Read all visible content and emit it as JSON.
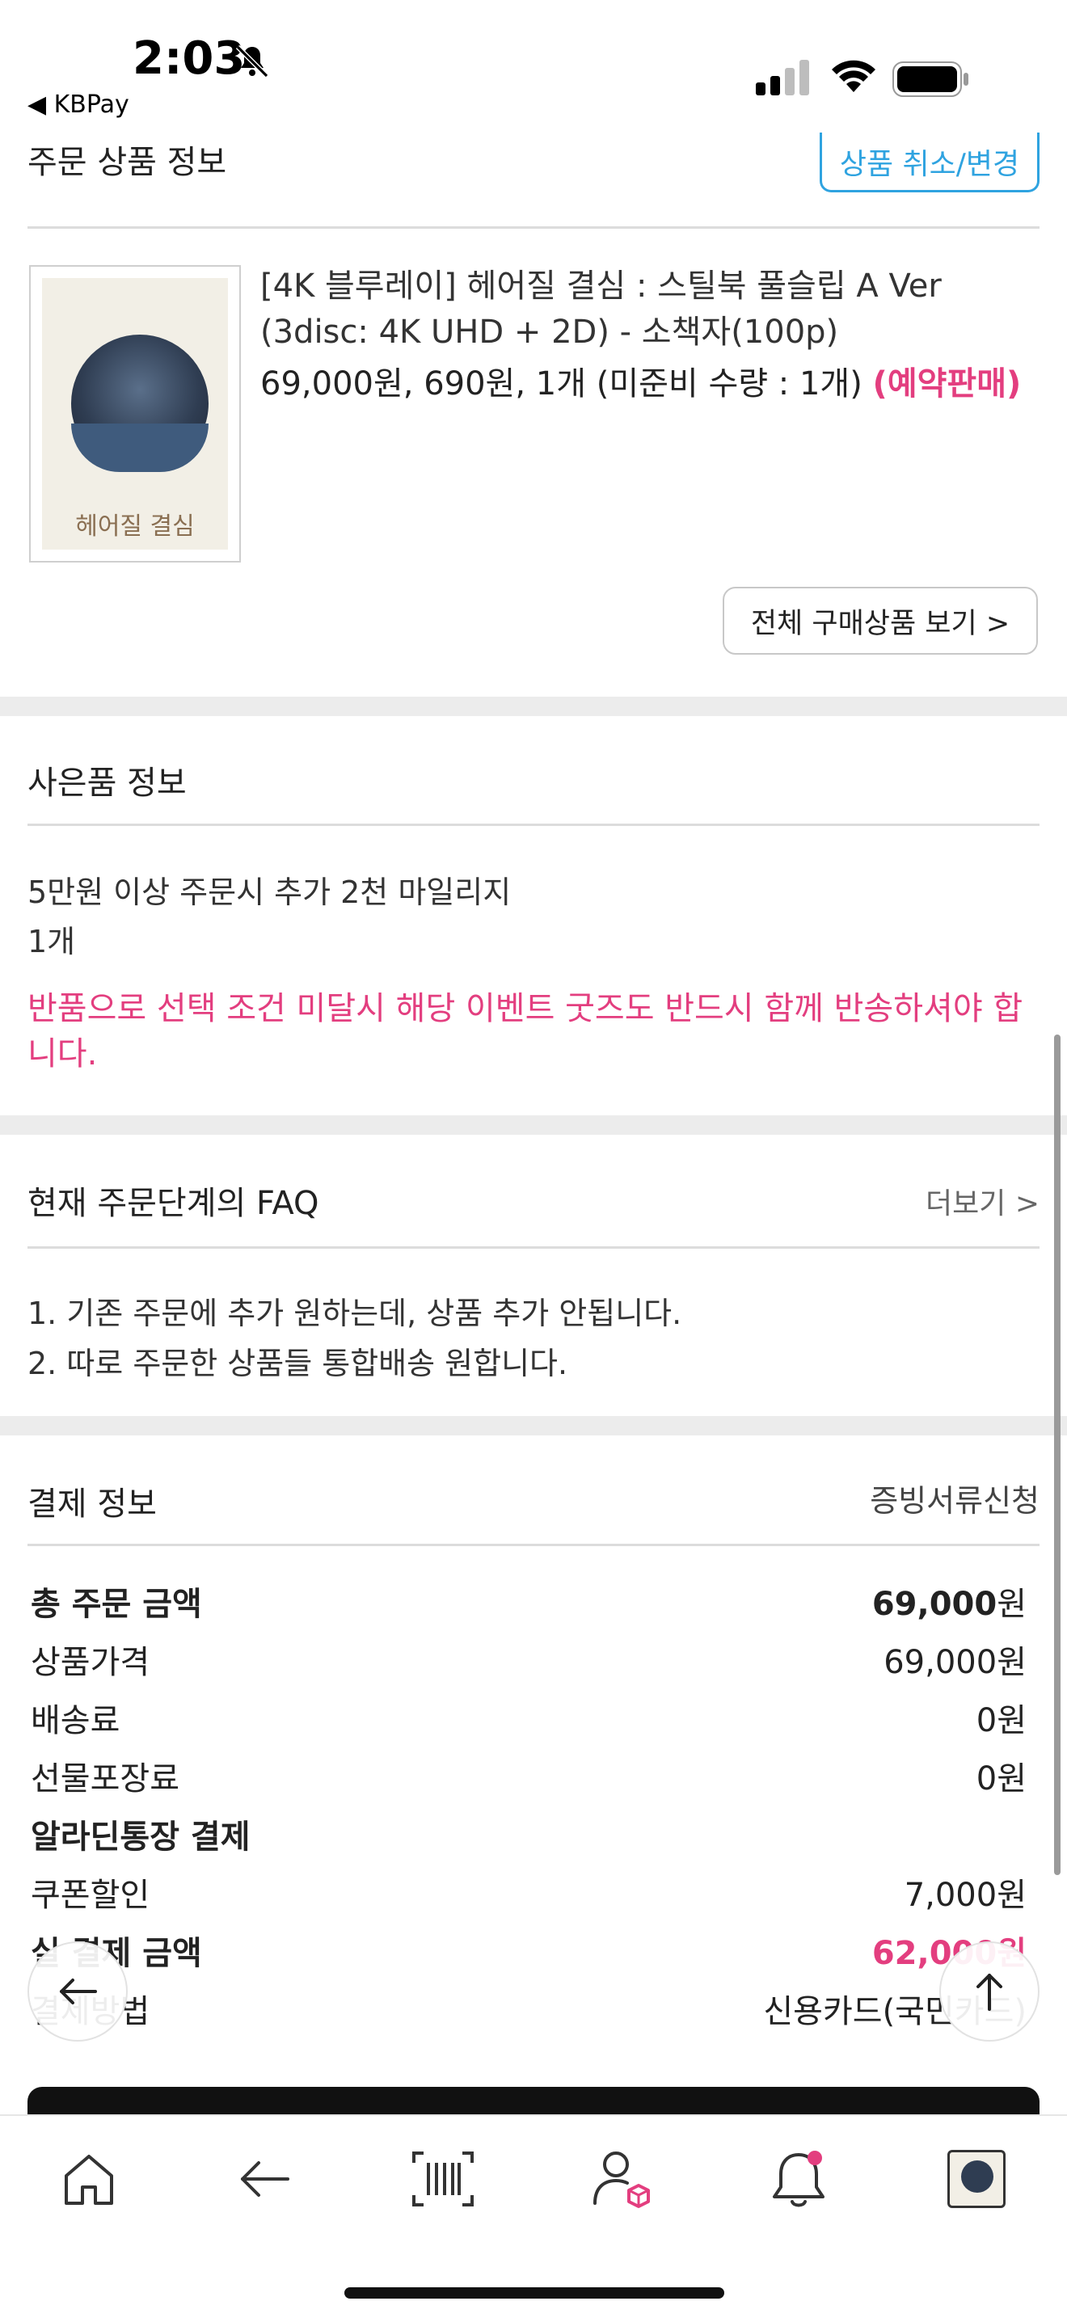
{
  "status_bar": {
    "time": "2:03",
    "back_app": "◀ KBPay"
  },
  "order_section": {
    "title_partial": "주문 상품 정보",
    "cancel_button": "상품 취소/변경",
    "product": {
      "name": "[4K 블루레이] 헤어질 결심 : 스틸북 풀슬립 A Ver (3disc: 4K UHD + 2D) - 소책자(100p)",
      "price_line": "69,000원, 690원, 1개 (미준비 수량 : 1개)",
      "preorder_tag": "(예약판매)",
      "thumbnail_title": "헤어질 결심"
    },
    "view_all_button": "전체 구매상품 보기 >"
  },
  "gift_section": {
    "title": "사은품 정보",
    "item": "5만원 이상 주문시 추가 2천 마일리지",
    "quantity": "1개",
    "notice": "반품으로 선택 조건 미달시 해당 이벤트 굿즈도 반드시 함께 반송하셔야 합니다."
  },
  "faq_section": {
    "title": "현재 주문단계의 FAQ",
    "more_link": "더보기 >",
    "items": [
      "1. 기존 주문에 추가 원하는데, 상품 추가 안됩니다.",
      "2. 따로 주문한 상품들 통합배송 원합니다."
    ]
  },
  "payment_section": {
    "title": "결제 정보",
    "doc_link": "증빙서류신청",
    "rows": [
      {
        "label": "총 주문 금액",
        "value_num": "69,000",
        "value_unit": "원"
      },
      {
        "label": "상품가격",
        "value": "69,000원"
      },
      {
        "label": "배송료",
        "value": "0원"
      },
      {
        "label": "선물포장료",
        "value": "0원"
      },
      {
        "label": "알라딘통장 결제",
        "value": ""
      },
      {
        "label": "쿠폰할인",
        "value": "7,000원"
      },
      {
        "label": "실 결제 금액",
        "value": "62,000원"
      },
      {
        "label": "결제방법",
        "value": "신용카드(국민카드)"
      }
    ]
  },
  "tab_bar": {
    "items": [
      "home-icon",
      "back-arrow-icon",
      "barcode-icon",
      "my-account-icon",
      "notification-bell-icon",
      "recent-product-thumbnail"
    ]
  },
  "colors": {
    "accent_pink": "#e33e7f",
    "link_blue": "#2fa3e0"
  }
}
